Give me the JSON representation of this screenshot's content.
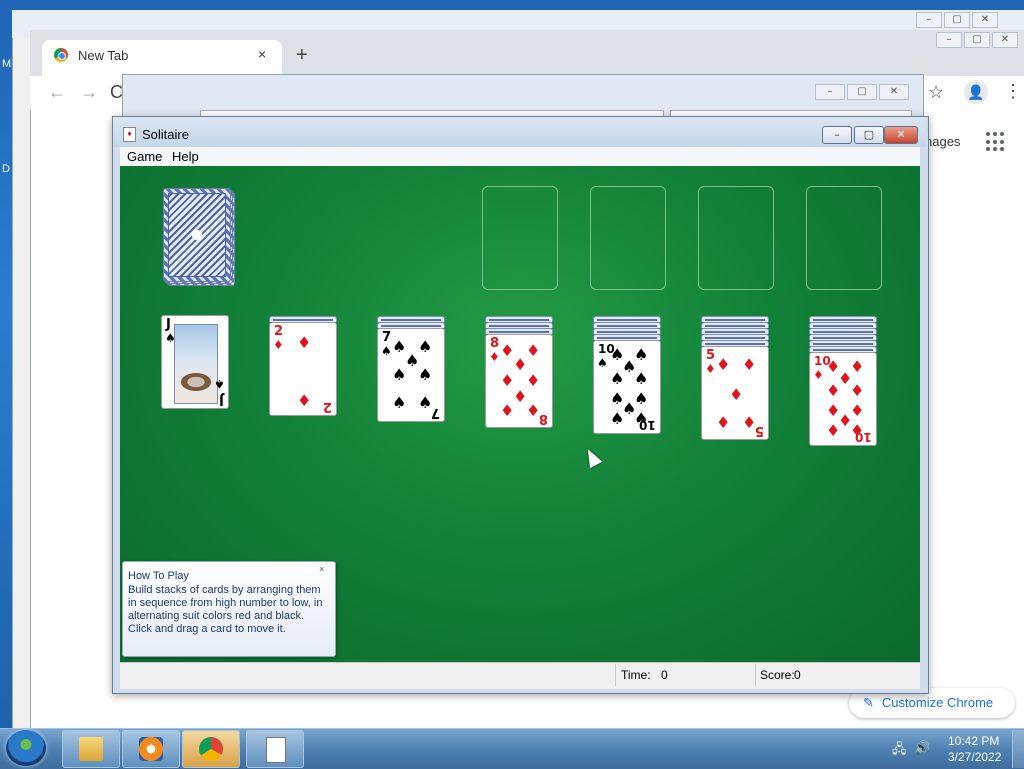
{
  "chrome": {
    "tab_title": "New Tab",
    "tab_close": "×",
    "new_tab": "+",
    "back": "←",
    "forward": "→",
    "reload": "C",
    "star": "☆",
    "profile": "👤",
    "menu": "⋮",
    "images_label": "nages",
    "customize_label": "Customize Chrome",
    "customize_icon": "✎"
  },
  "bg": {
    "left_letter_m": "M",
    "left_letter_d": "D",
    "min": "–",
    "max": "▢",
    "close": "✕"
  },
  "solitaire": {
    "title": "Solitaire",
    "menu": [
      "Game",
      "Help"
    ],
    "buttons": {
      "min": "–",
      "max": "▢",
      "close": "✕"
    },
    "status": {
      "time_label": "Time:",
      "time_value": "0",
      "score_label": "Score:",
      "score_value": "0"
    },
    "how_to_play": {
      "title": "How To Play",
      "body": "Build stacks of cards by arranging them in sequence from high number to low, in alternating suit colors red and black. Click and drag a card to move it.",
      "close": "×"
    },
    "tableau": [
      {
        "rank": "J",
        "suit": "♠",
        "color": "black",
        "hidden": 0
      },
      {
        "rank": "2",
        "suit": "♦",
        "color": "red",
        "hidden": 1
      },
      {
        "rank": "7",
        "suit": "♠",
        "color": "black",
        "hidden": 2
      },
      {
        "rank": "8",
        "suit": "♦",
        "color": "red",
        "hidden": 3
      },
      {
        "rank": "10",
        "suit": "♠",
        "color": "black",
        "hidden": 4
      },
      {
        "rank": "5",
        "suit": "♦",
        "color": "red",
        "hidden": 5
      },
      {
        "rank": "10",
        "suit": "♦",
        "color": "red",
        "hidden": 6
      }
    ],
    "stock": "face-down deck",
    "foundations_empty": 4
  },
  "taskbar": {
    "clock_time": "10:42 PM",
    "clock_date": "3/27/2022",
    "tray_network": "🖧",
    "tray_volume": "🔊"
  }
}
